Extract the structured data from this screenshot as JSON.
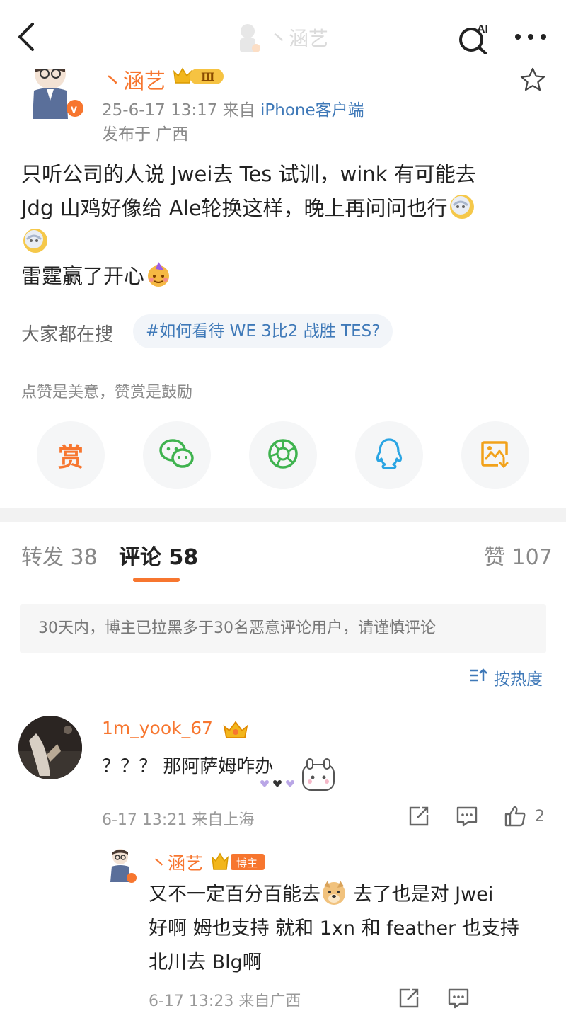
{
  "nav": {
    "title": "丶涵艺"
  },
  "post": {
    "author": "丶涵艺",
    "level_badge": "Ⅲ",
    "date": "25-6-17 13:17",
    "source_prefix": "来自",
    "source": "iPhone客户端",
    "location": "发布于 广西",
    "body_lines": [
      "只听公司的人说 Jwei去 Tes 试训，wink 有可能去",
      "Jdg 山鸡好像给 Ale轮换这样，晚上再问问也行",
      "",
      "雷霆赢了开心"
    ],
    "search_label": "大家都在搜",
    "search_tag": "#如何看待 WE 3比2 战胜 TES?",
    "reward_tip": "点赞是美意，赞赏是鼓励",
    "reward_button": "赏"
  },
  "share": {
    "icons": [
      "reward-icon",
      "wechat-icon",
      "moments-icon",
      "qq-icon",
      "save-image-icon"
    ],
    "colors": {
      "reward": "#f7762f",
      "wechat": "#3fb34f",
      "moments": "#3fb34f",
      "qq": "#2ba5e3",
      "save": "#f2a21b"
    }
  },
  "tabs": {
    "repost": "转发 38",
    "comments": "评论 58",
    "likes": "赞 107"
  },
  "notice": "30天内，博主已拉黑多于30名恶意评论用户，请谨慎评论",
  "sort_label": "按热度",
  "comments": [
    {
      "user": "1m_yook_67",
      "text": "？？？ 那阿萨姆咋办",
      "time": "6-17 13:21 来自上海",
      "likes": "2",
      "reply": {
        "user": "丶涵艺",
        "badge": "博主",
        "text_lines": [
          "又不一定百分百能去",
          "好啊 姆也支持 就和 1xn 和 feather 也支持",
          "北川去 Blg啊"
        ],
        "text_line1_after": " 去了也是对 Jwei",
        "time": "6-17 13:23 来自广西"
      }
    }
  ],
  "accent_color": "#f7762f",
  "link_color": "#3f79b8"
}
